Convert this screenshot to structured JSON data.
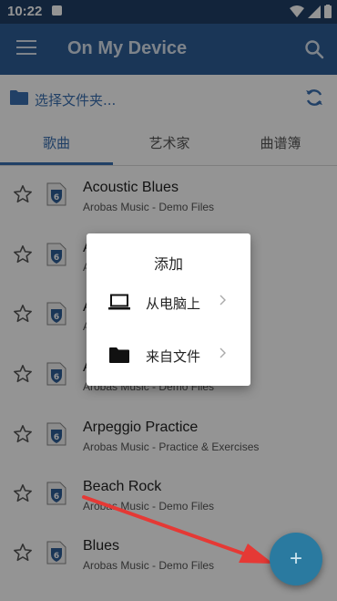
{
  "status_bar": {
    "time": "10:22"
  },
  "app_bar": {
    "title": "On My Device"
  },
  "folder": {
    "label": "选择文件夹..."
  },
  "tabs": [
    {
      "label": "歌曲",
      "active": true
    },
    {
      "label": "艺术家",
      "active": false
    },
    {
      "label": "曲谱簿",
      "active": false
    }
  ],
  "songs": [
    {
      "title": "Acoustic Blues",
      "subtitle": "Arobas Music - Demo Files"
    },
    {
      "title": "A",
      "subtitle": "A"
    },
    {
      "title": "A",
      "subtitle": "A"
    },
    {
      "title": "A",
      "subtitle": "Arobas Music - Demo Files"
    },
    {
      "title": "Arpeggio Practice",
      "subtitle": "Arobas Music - Practice & Exercises"
    },
    {
      "title": "Beach Rock",
      "subtitle": "Arobas Music - Demo Files"
    },
    {
      "title": "Blues",
      "subtitle": "Arobas Music - Demo Files"
    }
  ],
  "dialog": {
    "title": "添加",
    "options": [
      {
        "label": "从电脑上",
        "icon": "laptop-icon"
      },
      {
        "label": "来自文件",
        "icon": "folder-icon"
      }
    ]
  },
  "fab": {
    "label": "+"
  },
  "colors": {
    "app_bar": "#2d5d97",
    "accent": "#3a6fb0",
    "fab": "#2a7aa0",
    "arrow": "#e53935"
  }
}
